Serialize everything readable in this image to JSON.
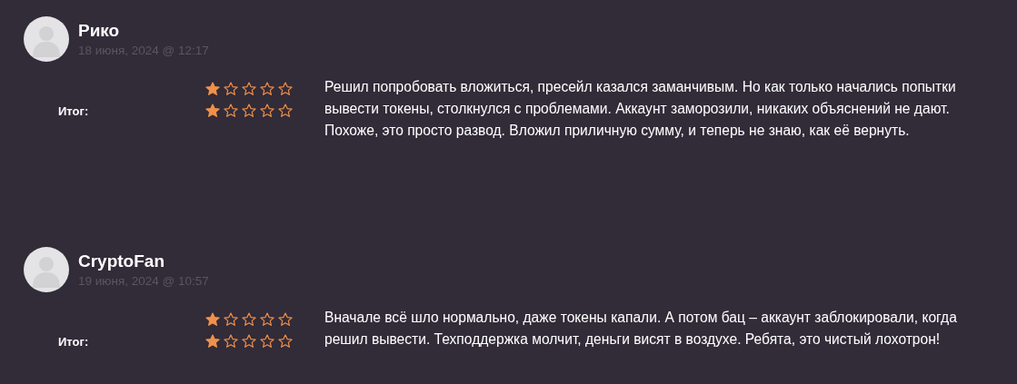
{
  "reviews": [
    {
      "author": "Рико",
      "date": "18 июня, 2024 @ 12:17",
      "ratings": [
        {
          "stars": 1
        },
        {
          "label": "Итог:",
          "stars": 1
        }
      ],
      "text": "Решил попробовать вложиться, пресейл казался заманчивым. Но как только начались попытки вывести токены, столкнулся с проблемами. Аккаунт заморозили, никаких объяснений не дают. Похоже, это просто развод. Вложил приличную сумму, и теперь не знаю, как её вернуть."
    },
    {
      "author": "CryptoFan",
      "date": "19 июня, 2024 @ 10:57",
      "ratings": [
        {
          "stars": 1
        },
        {
          "label": "Итог:",
          "stars": 1
        }
      ],
      "text": "Вначале всё шло нормально, даже токены капали. А потом бац – аккаунт заблокировали, когда решил вывести. Техподдержка молчит, деньги висят в воздухе. Ребята, это чистый лохотрон!"
    }
  ]
}
